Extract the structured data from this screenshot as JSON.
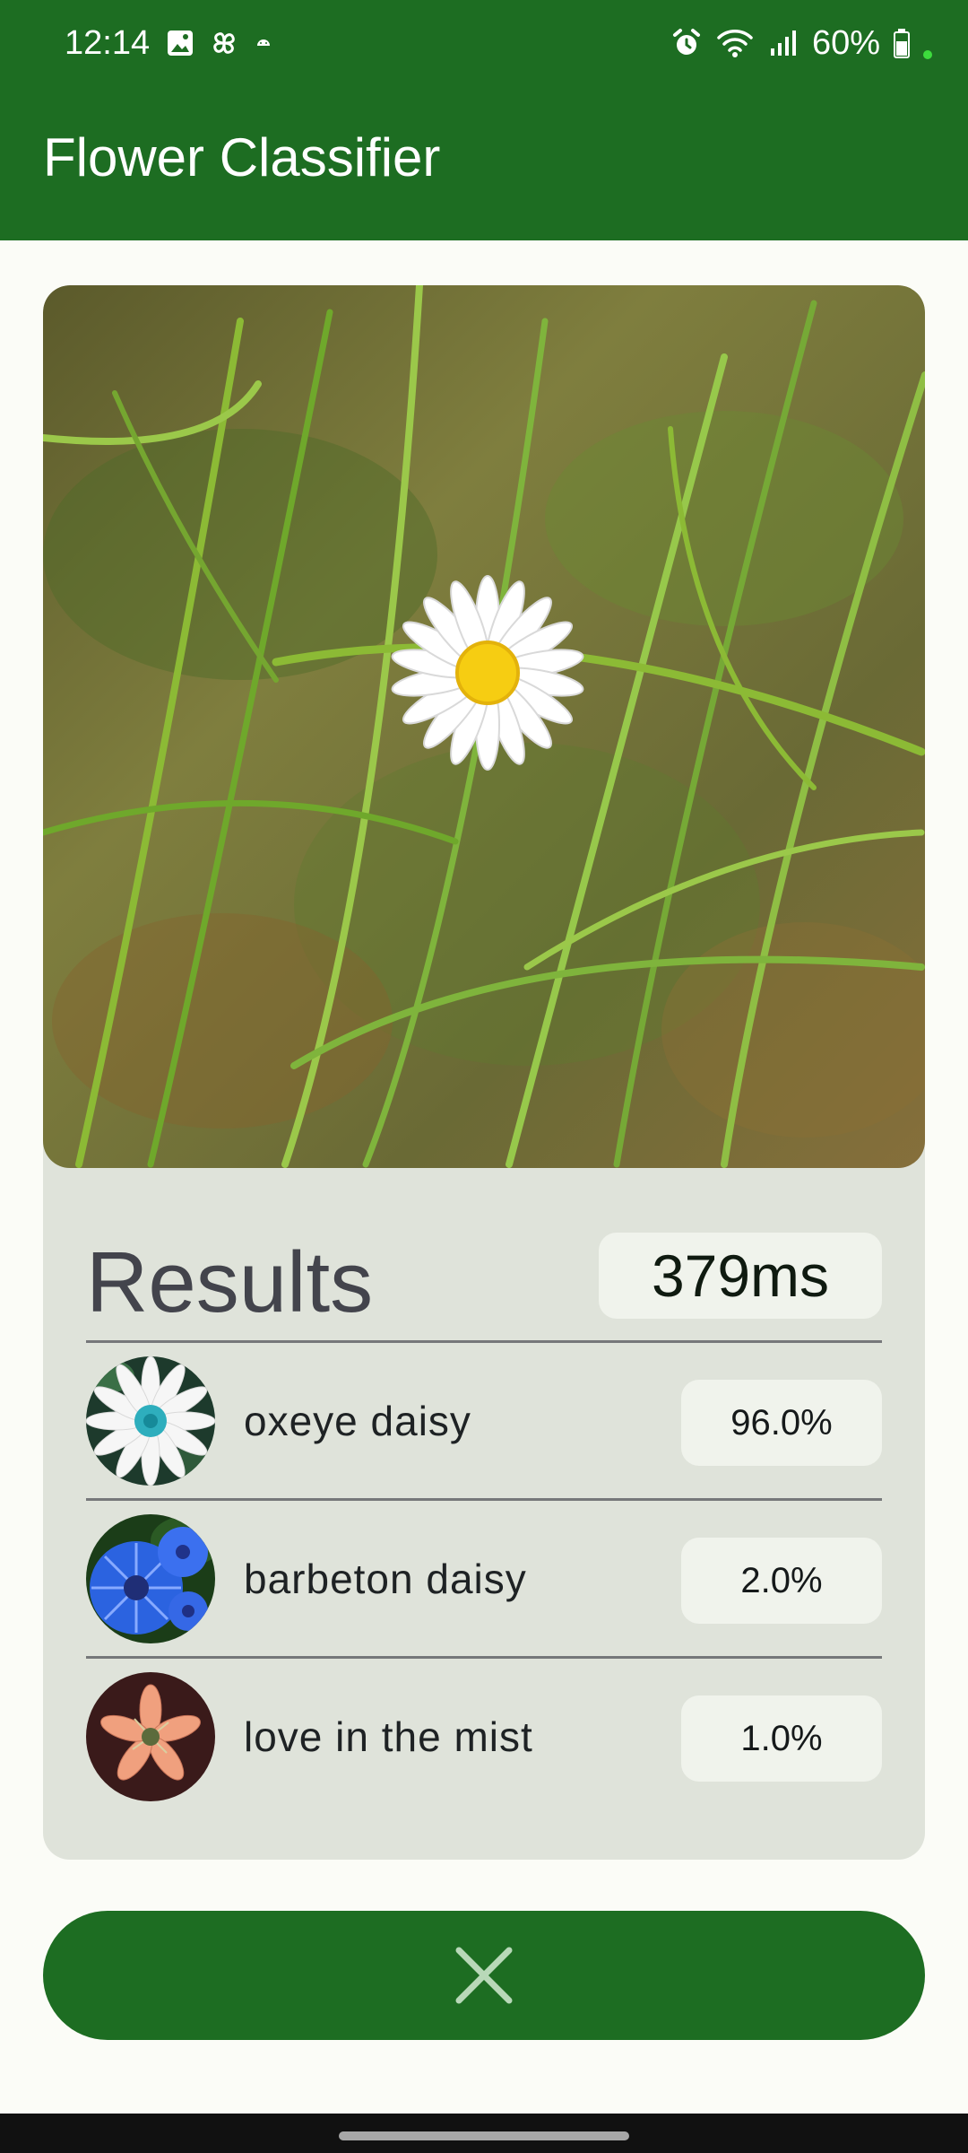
{
  "status_bar": {
    "time": "12:14",
    "battery": "60%",
    "left_icons": [
      "image-icon",
      "pinwheel-icon",
      "android-icon"
    ],
    "right_icons": [
      "alarm-icon",
      "wifi-icon",
      "signal-icon",
      "battery-icon"
    ]
  },
  "app_bar": {
    "title": "Flower Classifier"
  },
  "photo": {
    "description_icon": "daisy-photo"
  },
  "results": {
    "title": "Results",
    "inference_time": "379ms",
    "items": [
      {
        "label": "oxeye daisy",
        "score": "96.0%",
        "thumb_icon": "oxeye-daisy-thumbnail"
      },
      {
        "label": "barbeton daisy",
        "score": "2.0%",
        "thumb_icon": "barbeton-daisy-thumbnail"
      },
      {
        "label": "love in the mist",
        "score": "1.0%",
        "thumb_icon": "love-in-the-mist-thumbnail"
      }
    ]
  },
  "actions": {
    "close_icon": "close-icon"
  },
  "colors": {
    "primary": "#1d6d22",
    "card_background": "#dfe3da",
    "chip_background": "#f0f3ec",
    "page_background": "#fbfcf7"
  }
}
